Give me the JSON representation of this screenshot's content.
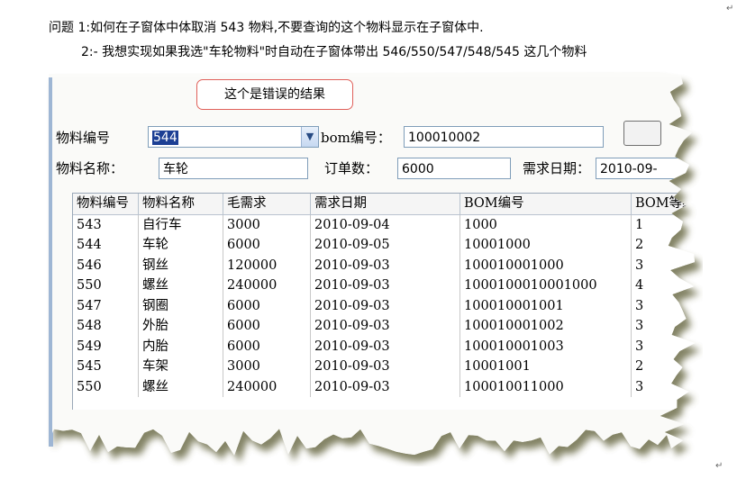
{
  "doc": {
    "question1": "问题 1:如何在子窗体中体取消 543 物料,不要查询的这个物料显示在子窗体中.",
    "question2": "2:- 我想实现如果我选\"车轮物料\"时自动在子窗体带出 546/550/547/548/545 这几个物料",
    "para_mark": "↵"
  },
  "callout": "这个是错误的结果",
  "form": {
    "material_no_label": "物料编号",
    "material_no_value": "544",
    "bom_label": "bom编号：",
    "bom_value": "100010002",
    "material_name_label": "物料名称：",
    "material_name_value": "车轮",
    "order_qty_label": "订单数：",
    "order_qty_value": "6000",
    "demand_date_label": "需求日期：",
    "demand_date_value": "2010-09-"
  },
  "grid": {
    "headers": [
      "物料编号",
      "物料名称",
      "毛需求",
      "需求日期",
      "BOM编号",
      "BOM等级"
    ],
    "rows": [
      [
        "543",
        "自行车",
        "3000",
        "2010-09-04",
        "1000",
        "1"
      ],
      [
        "544",
        "车轮",
        "6000",
        "2010-09-05",
        "10001000",
        "2"
      ],
      [
        "546",
        "钢丝",
        "120000",
        "2010-09-03",
        "100010001000",
        "3"
      ],
      [
        "550",
        "螺丝",
        "240000",
        "2010-09-03",
        "1000100010001000",
        "4"
      ],
      [
        "547",
        "钢圈",
        "6000",
        "2010-09-03",
        "100010001001",
        "3"
      ],
      [
        "548",
        "外胎",
        "6000",
        "2010-09-03",
        "100010001002",
        "3"
      ],
      [
        "549",
        "内胎",
        "6000",
        "2010-09-03",
        "100010001003",
        "3"
      ],
      [
        "545",
        "车架",
        "3000",
        "2010-09-03",
        "10001001",
        "2"
      ],
      [
        "550",
        "螺丝",
        "240000",
        "2010-09-03",
        "100010011000",
        "3"
      ]
    ]
  },
  "icons": {
    "combo_arrow": "chevron-down-icon"
  }
}
